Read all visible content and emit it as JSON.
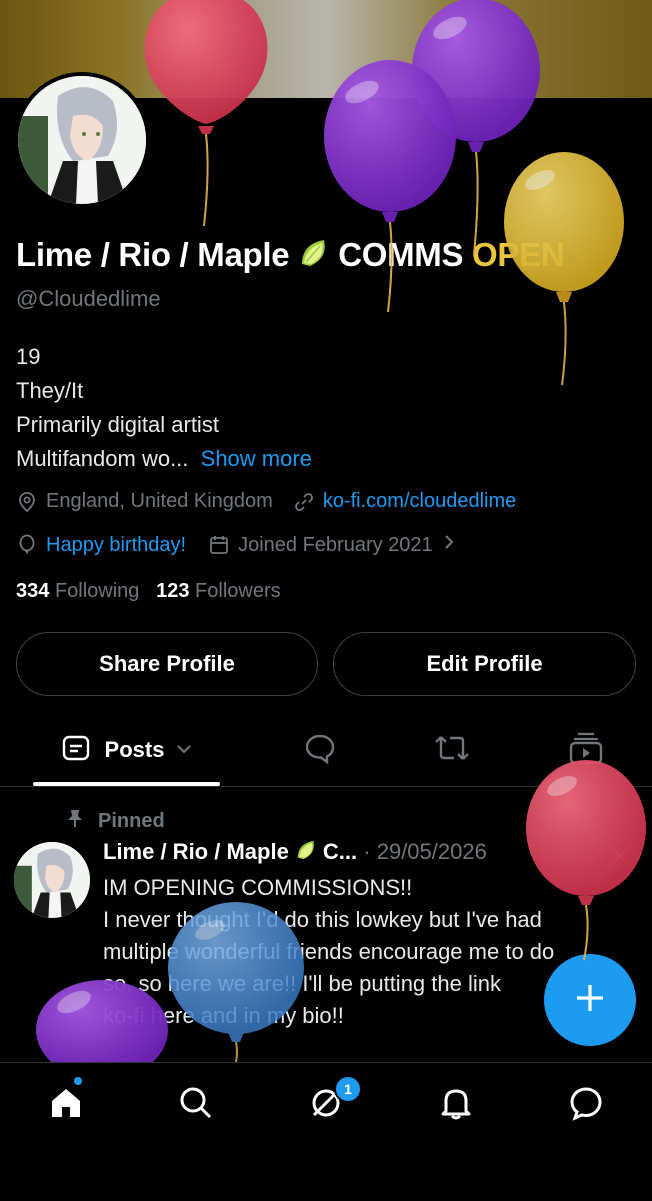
{
  "profile": {
    "display_name_main": "Lime / Rio / Maple ",
    "display_name_emoji": "lime-emoji",
    "display_name_comms": "COMMS ",
    "display_name_open": "OPEN",
    "handle": "@Cloudedlime",
    "bio_lines": [
      "19",
      "They/It",
      "Primarily digital artist"
    ],
    "bio_truncated": "Multifandom wo...",
    "show_more": "Show more",
    "location": "England, United Kingdom",
    "website": "ko-fi.com/cloudedlime",
    "birthday": "Happy birthday!",
    "joined": "Joined February 2021",
    "following_count": "334",
    "following_label": "Following",
    "followers_count": "123",
    "followers_label": "Followers"
  },
  "buttons": {
    "share": "Share Profile",
    "edit": "Edit Profile"
  },
  "tabs": [
    {
      "label": "Posts",
      "icon": "posts-icon",
      "active": true
    },
    {
      "label": "",
      "icon": "replies-icon"
    },
    {
      "label": "",
      "icon": "reposts-icon"
    },
    {
      "label": "",
      "icon": "media-icon"
    }
  ],
  "post": {
    "pinned_label": "Pinned",
    "author": "Lime / Rio / Maple ",
    "author_trunc": "C...",
    "date": "· 29/05/2026",
    "lines": [
      "IM OPENING COMMISSIONS!!",
      "I never thought I'd do this lowkey but I've had",
      "multiple wonderful friends encourage me to do",
      "so, so here we are!! I'll be putting the link",
      "ko-fi here and in my bio!!"
    ]
  },
  "nav": {
    "items": [
      "home-icon",
      "search-icon",
      "grok-icon",
      "notifications-icon",
      "messages-icon"
    ],
    "badge_count": "1"
  },
  "colors": {
    "accent": "#1d9bf0",
    "balloon_red": "#e0465c",
    "balloon_purple": "#8a35d6",
    "balloon_yellow": "#e8c53c",
    "balloon_blue": "#4a8ed8"
  }
}
